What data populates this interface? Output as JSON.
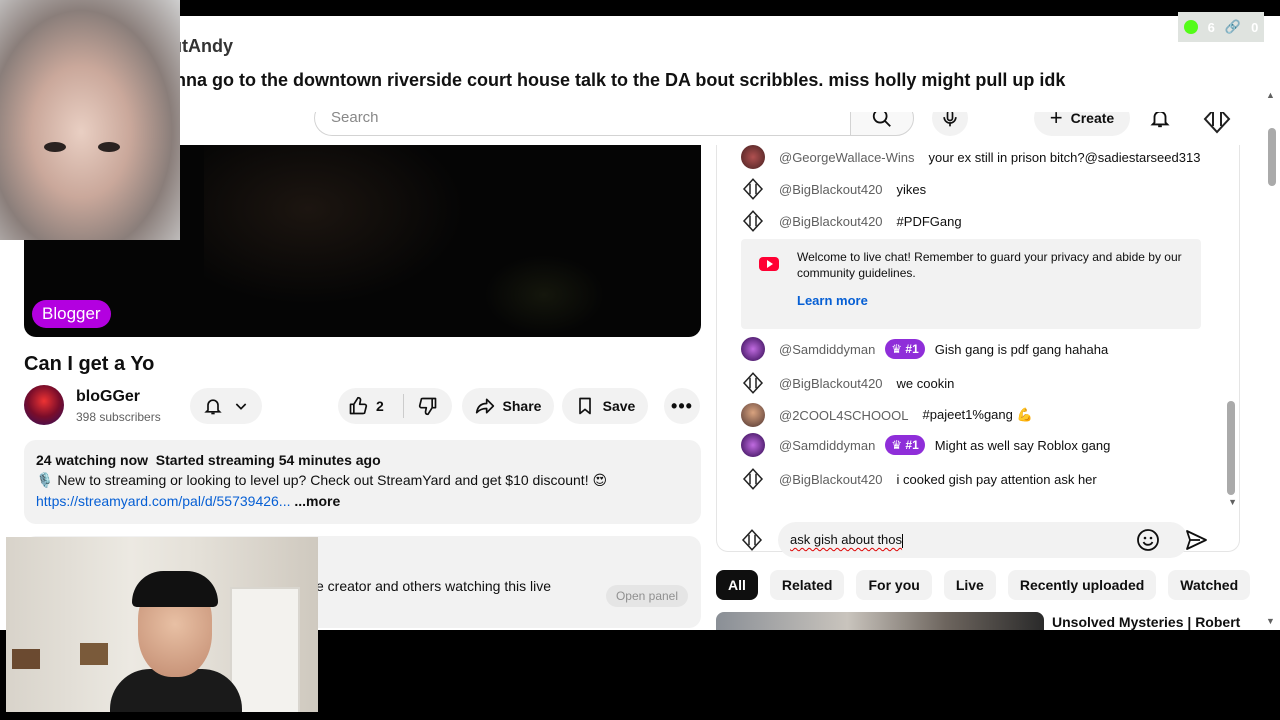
{
  "banner": {
    "username": "BlackoutAndy",
    "message": "i am gonna go to the downtown riverside court house talk to the DA bout scribbles. miss holly might pull up idk",
    "stat_views": "6",
    "stat_links": "0"
  },
  "masthead": {
    "search_placeholder": "Search",
    "create_label": "Create"
  },
  "video": {
    "badge": "Blogger",
    "title": "Can I get a Yo"
  },
  "channel": {
    "name": "bloGGer",
    "subscribers": "398 subscribers"
  },
  "actions": {
    "like_count": "2",
    "share_label": "Share",
    "save_label": "Save"
  },
  "description": {
    "watching": "24 watching now",
    "started": "Started streaming 54 minutes ago",
    "promo": "New to streaming or looking to level up? Check out StreamYard and get $10 discount! 😍",
    "link": "https://streamyard.com/pal/d/55739426...",
    "more": "...more"
  },
  "panel": {
    "text": "e creator and others watching this live",
    "open_label": "Open panel"
  },
  "chat": {
    "messages": [
      {
        "author": "@GeorgeWallace-Wins",
        "text": "your ex still in prison bitch?@sadiestarseed313"
      },
      {
        "author": "@BigBlackout420",
        "text": "yikes"
      },
      {
        "author": "@BigBlackout420",
        "text": "#PDFGang"
      },
      {
        "author": "@Samdiddyman",
        "badge": "#1",
        "text": "Gish gang is pdf gang hahaha"
      },
      {
        "author": "@BigBlackout420",
        "text": "we cookin"
      },
      {
        "author": "@2COOL4SCHOOOL",
        "text": "#pajeet1%gang 💪"
      },
      {
        "author": "@Samdiddyman",
        "badge": "#1",
        "text": "Might as well say Roblox gang"
      },
      {
        "author": "@BigBlackout420",
        "text": "i cooked gish pay attention ask her"
      }
    ],
    "welcome_text": "Welcome to live chat! Remember to guard your privacy and abide by our community guidelines.",
    "learn_more": "Learn more",
    "input_value": "ask gish about thos"
  },
  "chips": [
    "All",
    "Related",
    "For you",
    "Live",
    "Recently uploaded",
    "Watched"
  ],
  "recommendation": {
    "title": "Unsolved Mysteries | Robert"
  },
  "colors": {
    "kick_green": "#53fc18",
    "blogger_purple": "#b300e0",
    "badge_purple": "#8f2ed9",
    "youtube_red": "#ff0033",
    "link_blue": "#065fd4"
  }
}
